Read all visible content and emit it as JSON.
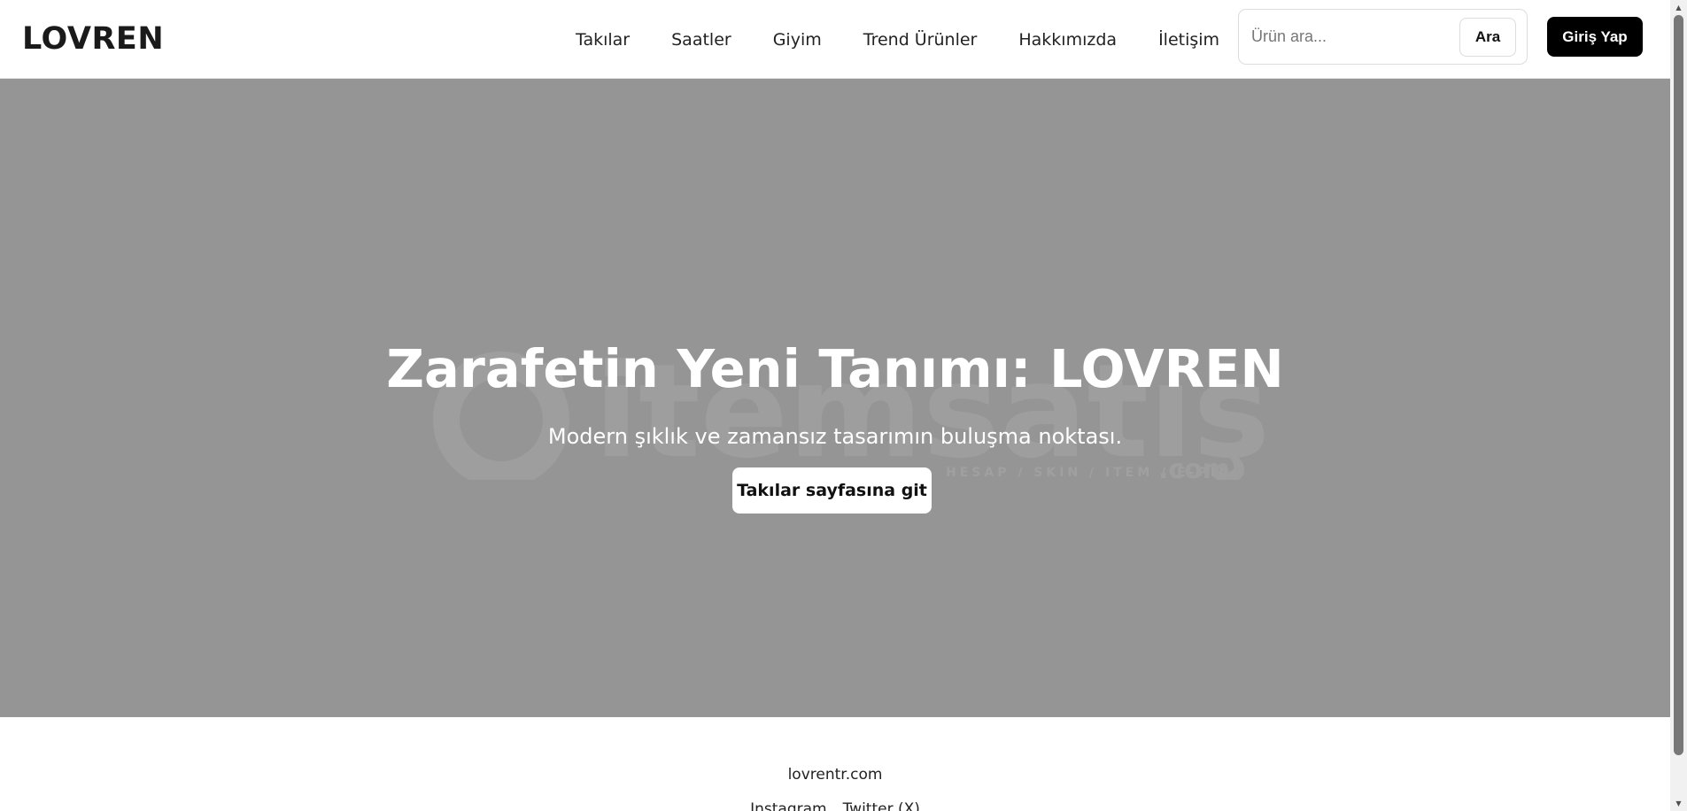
{
  "header": {
    "logo": "LOVREN",
    "nav": [
      "Takılar",
      "Saatler",
      "Giyim",
      "Trend Ürünler",
      "Hakkımızda",
      "İletişim"
    ],
    "search": {
      "placeholder": "Ürün ara...",
      "value": "",
      "button_label": "Ara"
    },
    "login_label": "Giriş Yap"
  },
  "hero": {
    "title": "Zarafetin Yeni Tanımı: LOVREN",
    "subtitle": "Modern şıklık ve zamansız tasarımın buluşma noktası.",
    "cta_label": "Takılar sayfasına git",
    "background_color": "#959595",
    "watermark": {
      "brand": "itemsatış",
      "tagline": "HESAP / SKIN / ITEM / E-PIN",
      "suffix": ".com"
    }
  },
  "footer": {
    "domain": "lovrentr.com",
    "social": [
      "Instagram",
      "Twitter (X)"
    ]
  },
  "colors": {
    "accent": "#000000",
    "text": "#222222",
    "hero_text": "#ffffff"
  },
  "icons": [
    "scroll-up-arrow-icon",
    "scroll-down-arrow-icon",
    "itemsatis-logo-icon"
  ]
}
